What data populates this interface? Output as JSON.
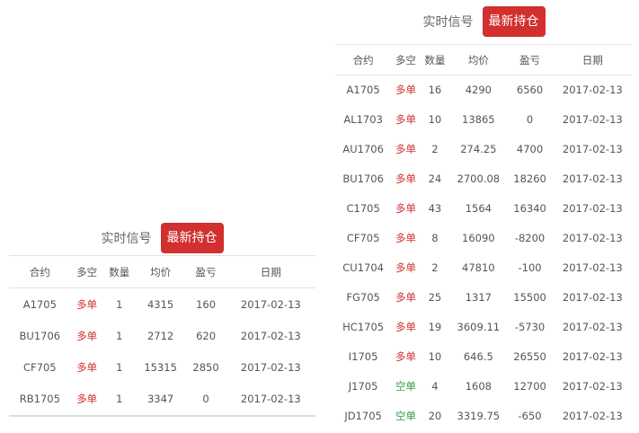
{
  "left_panel": {
    "tab_label": "实时信号",
    "button_label": "最新持仓",
    "columns": [
      "合约",
      "多空",
      "数量",
      "均价",
      "盈亏",
      "日期"
    ],
    "rows": [
      {
        "contract": "A1705",
        "side": "多单",
        "side_type": "long",
        "qty": "1",
        "avg": "4315",
        "pnl": "160",
        "date": "2017-02-13"
      },
      {
        "contract": "BU1706",
        "side": "多单",
        "side_type": "long",
        "qty": "1",
        "avg": "2712",
        "pnl": "620",
        "date": "2017-02-13"
      },
      {
        "contract": "CF705",
        "side": "多单",
        "side_type": "long",
        "qty": "1",
        "avg": "15315",
        "pnl": "2850",
        "date": "2017-02-13"
      },
      {
        "contract": "RB1705",
        "side": "多单",
        "side_type": "long",
        "qty": "1",
        "avg": "3347",
        "pnl": "0",
        "date": "2017-02-13"
      }
    ]
  },
  "right_panel": {
    "tab_label": "实时信号",
    "button_label": "最新持仓",
    "columns": [
      "合约",
      "多空",
      "数量",
      "均价",
      "盈亏",
      "日期"
    ],
    "rows": [
      {
        "contract": "A1705",
        "side": "多单",
        "side_type": "long",
        "qty": "16",
        "avg": "4290",
        "pnl": "6560",
        "date": "2017-02-13"
      },
      {
        "contract": "AL1703",
        "side": "多单",
        "side_type": "long",
        "qty": "10",
        "avg": "13865",
        "pnl": "0",
        "date": "2017-02-13"
      },
      {
        "contract": "AU1706",
        "side": "多单",
        "side_type": "long",
        "qty": "2",
        "avg": "274.25",
        "pnl": "4700",
        "date": "2017-02-13"
      },
      {
        "contract": "BU1706",
        "side": "多单",
        "side_type": "long",
        "qty": "24",
        "avg": "2700.08",
        "pnl": "18260",
        "date": "2017-02-13"
      },
      {
        "contract": "C1705",
        "side": "多单",
        "side_type": "long",
        "qty": "43",
        "avg": "1564",
        "pnl": "16340",
        "date": "2017-02-13"
      },
      {
        "contract": "CF705",
        "side": "多单",
        "side_type": "long",
        "qty": "8",
        "avg": "16090",
        "pnl": "-8200",
        "date": "2017-02-13"
      },
      {
        "contract": "CU1704",
        "side": "多单",
        "side_type": "long",
        "qty": "2",
        "avg": "47810",
        "pnl": "-100",
        "date": "2017-02-13"
      },
      {
        "contract": "FG705",
        "side": "多单",
        "side_type": "long",
        "qty": "25",
        "avg": "1317",
        "pnl": "15500",
        "date": "2017-02-13"
      },
      {
        "contract": "HC1705",
        "side": "多单",
        "side_type": "long",
        "qty": "19",
        "avg": "3609.11",
        "pnl": "-5730",
        "date": "2017-02-13"
      },
      {
        "contract": "I1705",
        "side": "多单",
        "side_type": "long",
        "qty": "10",
        "avg": "646.5",
        "pnl": "26550",
        "date": "2017-02-13"
      },
      {
        "contract": "J1705",
        "side": "空单",
        "side_type": "short",
        "qty": "4",
        "avg": "1608",
        "pnl": "12700",
        "date": "2017-02-13"
      },
      {
        "contract": "JD1705",
        "side": "空单",
        "side_type": "short",
        "qty": "20",
        "avg": "3319.75",
        "pnl": "-650",
        "date": "2017-02-13"
      }
    ]
  },
  "colors": {
    "accent": "#d22f2f",
    "long": "#d22f2f",
    "short": "#2e9e3e"
  }
}
